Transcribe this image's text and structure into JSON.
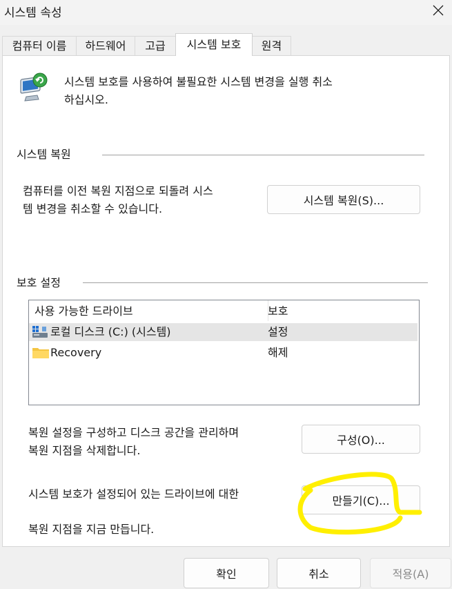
{
  "window": {
    "title": "시스템 속성",
    "close_icon": "close-icon"
  },
  "tabs": [
    {
      "label": "컴퓨터 이름",
      "active": false
    },
    {
      "label": "하드웨어",
      "active": false
    },
    {
      "label": "고급",
      "active": false
    },
    {
      "label": "시스템 보호",
      "active": true
    },
    {
      "label": "원격",
      "active": false
    }
  ],
  "intro": {
    "icon": "system-protection-icon",
    "line1": "시스템 보호를 사용하여 불필요한 시스템 변경을 실행 취소",
    "line2": "하십시오."
  },
  "restore_section": {
    "heading": "시스템 복원",
    "desc_line1": "컴퓨터를 이전 복원 지점으로 되돌려 시스",
    "desc_line2": "템 변경을 취소할 수 있습니다.",
    "button": "시스템 복원(S)..."
  },
  "protection_section": {
    "heading": "보호 설정",
    "columns": [
      "사용 가능한 드라이브",
      "보호"
    ],
    "drives": [
      {
        "name": "로컬 디스크 (C:) (시스템)",
        "status": "설정",
        "icon": "system-drive-icon",
        "selected": true
      },
      {
        "name": "Recovery",
        "status": "해제",
        "icon": "folder-icon",
        "selected": false
      }
    ],
    "configure_desc_line1": "복원 설정을 구성하고 디스크 공간을 관리하며",
    "configure_desc_line2": "복원 지점을 삭제합니다.",
    "configure_button": "구성(O)...",
    "create_desc_line1": "시스템 보호가 설정되어 있는 드라이브에 대한",
    "create_desc_line2": "복원 지점을 지금 만듭니다.",
    "create_button": "만들기(C)..."
  },
  "annotation": {
    "color": "#ffef00",
    "shape": "highlight-circle"
  },
  "footer": {
    "ok": "확인",
    "cancel": "취소",
    "apply": "적용(A)"
  }
}
